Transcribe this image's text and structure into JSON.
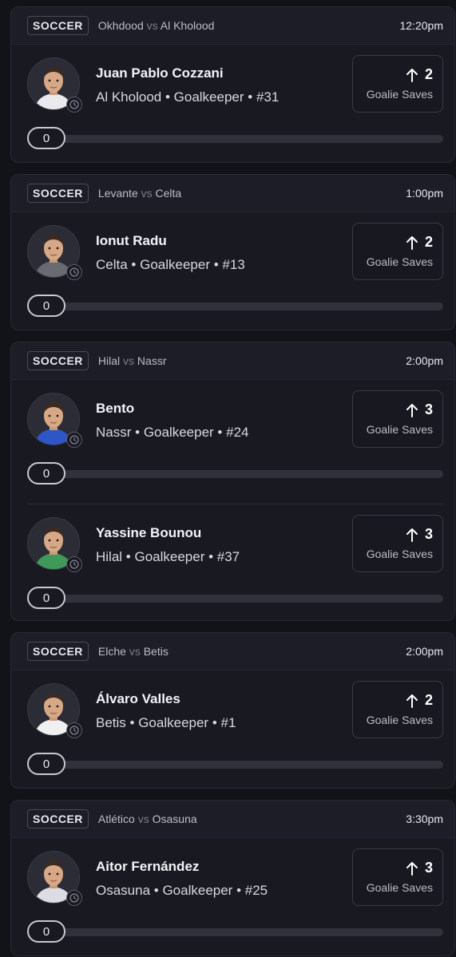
{
  "colors": {
    "background": "#121219",
    "card": "#191922",
    "track": "#31313c"
  },
  "games": [
    {
      "sport": "SOCCER",
      "home": "Okhdood",
      "vs": "vs",
      "away": "Al Kholood",
      "time": "12:20pm",
      "players": [
        {
          "name": "Juan Pablo Cozzani",
          "team": "Al Kholood",
          "position": "Goalkeeper",
          "number": "#31",
          "line": "2",
          "stat": "Goalie Saves",
          "progress": "0",
          "avatar_icon": "player-photo",
          "jersey": "#e9e9ee"
        }
      ]
    },
    {
      "sport": "SOCCER",
      "home": "Levante",
      "vs": "vs",
      "away": "Celta",
      "time": "1:00pm",
      "players": [
        {
          "name": "Ionut Radu",
          "team": "Celta",
          "position": "Goalkeeper",
          "number": "#13",
          "line": "2",
          "stat": "Goalie Saves",
          "progress": "0",
          "avatar_icon": "player-photo",
          "jersey": "#6a6a72"
        }
      ]
    },
    {
      "sport": "SOCCER",
      "home": "Hilal",
      "vs": "vs",
      "away": "Nassr",
      "time": "2:00pm",
      "players": [
        {
          "name": "Bento",
          "team": "Nassr",
          "position": "Goalkeeper",
          "number": "#24",
          "line": "3",
          "stat": "Goalie Saves",
          "progress": "0",
          "avatar_icon": "player-photo",
          "jersey": "#2f56c8"
        },
        {
          "name": "Yassine Bounou",
          "team": "Hilal",
          "position": "Goalkeeper",
          "number": "#37",
          "line": "3",
          "stat": "Goalie Saves",
          "progress": "0",
          "avatar_icon": "player-photo",
          "jersey": "#3f9a5a"
        }
      ]
    },
    {
      "sport": "SOCCER",
      "home": "Elche",
      "vs": "vs",
      "away": "Betis",
      "time": "2:00pm",
      "players": [
        {
          "name": "Álvaro Valles",
          "team": "Betis",
          "position": "Goalkeeper",
          "number": "#1",
          "line": "2",
          "stat": "Goalie Saves",
          "progress": "0",
          "avatar_icon": "player-photo",
          "jersey": "#f0f0f0"
        }
      ]
    },
    {
      "sport": "SOCCER",
      "home": "Atlético",
      "vs": "vs",
      "away": "Osasuna",
      "time": "3:30pm",
      "players": [
        {
          "name": "Aitor Fernández",
          "team": "Osasuna",
          "position": "Goalkeeper",
          "number": "#25",
          "line": "3",
          "stat": "Goalie Saves",
          "progress": "0",
          "avatar_icon": "player-photo",
          "jersey": "#dcdce2"
        }
      ]
    }
  ]
}
